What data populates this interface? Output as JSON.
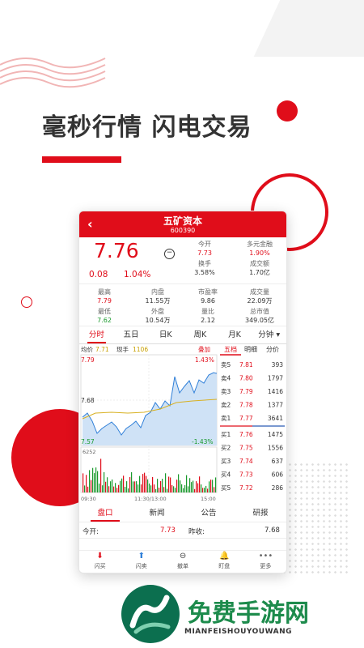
{
  "headline": "毫秒行情 闪电交易",
  "stock": {
    "name": "五矿资本",
    "code": "600390",
    "price": "7.76",
    "change": "0.08",
    "change_pct": "1.04%"
  },
  "quote_kv": [
    {
      "k": "今开",
      "v": "7.73",
      "c": "r"
    },
    {
      "k": "多元金融",
      "v": "1.90%",
      "c": "r"
    },
    {
      "k": "换手",
      "v": "3.58%",
      "c": "v"
    },
    {
      "k": "成交额",
      "v": "1.70亿",
      "c": "v"
    }
  ],
  "stats": [
    {
      "k": "最高",
      "v": "7.79",
      "c": "r"
    },
    {
      "k": "内盘",
      "v": "11.55万",
      "c": "v"
    },
    {
      "k": "市盈率",
      "v": "9.86",
      "c": "v"
    },
    {
      "k": "成交量",
      "v": "22.09万",
      "c": "v"
    },
    {
      "k": "最低",
      "v": "7.62",
      "c": "g"
    },
    {
      "k": "外盘",
      "v": "10.54万",
      "c": "v"
    },
    {
      "k": "量比",
      "v": "2.12",
      "c": "v"
    },
    {
      "k": "总市值",
      "v": "349.05亿",
      "c": "v"
    }
  ],
  "tabs": [
    "分时",
    "五日",
    "日K",
    "周K",
    "月K",
    "分钟 ▾"
  ],
  "chart": {
    "avg_label": "均价",
    "avg_val": "7.71",
    "now_label": "现手",
    "now_val": "1106",
    "overlay": "叠加",
    "hi": "7.79",
    "mid": "7.68",
    "lo": "7.57",
    "hi_pct": "1.43%",
    "lo_pct": "-1.43%",
    "vol": "6252",
    "t0": "09:30",
    "t1": "11:30/13:00",
    "t2": "15:00"
  },
  "book_tabs": [
    "五档",
    "明细",
    "分价"
  ],
  "asks": [
    {
      "l": "卖5",
      "p": "7.81",
      "v": "393"
    },
    {
      "l": "卖4",
      "p": "7.80",
      "v": "1797"
    },
    {
      "l": "卖3",
      "p": "7.79",
      "v": "1416"
    },
    {
      "l": "卖2",
      "p": "7.78",
      "v": "1377"
    },
    {
      "l": "卖1",
      "p": "7.77",
      "v": "3641"
    }
  ],
  "bids": [
    {
      "l": "买1",
      "p": "7.76",
      "v": "1475"
    },
    {
      "l": "买2",
      "p": "7.75",
      "v": "1556"
    },
    {
      "l": "买3",
      "p": "7.74",
      "v": "637"
    },
    {
      "l": "买4",
      "p": "7.73",
      "v": "606"
    },
    {
      "l": "买5",
      "p": "7.72",
      "v": "286"
    }
  ],
  "bottom_tabs": [
    "盘口",
    "新闻",
    "公告",
    "研报"
  ],
  "open_row": {
    "k1": "今开:",
    "v1": "7.73",
    "k2": "昨收:",
    "v2": "7.68"
  },
  "nav": [
    {
      "icon": "⬇",
      "label": "闪买"
    },
    {
      "icon": "⬆",
      "label": "闪卖"
    },
    {
      "icon": "⊖",
      "label": "撤单"
    },
    {
      "icon": "🔔",
      "label": "盯盘"
    },
    {
      "icon": "•••",
      "label": "更多"
    }
  ],
  "logo": {
    "title": "免费手游网",
    "sub": "MIANFEISHOUYOUWANG"
  },
  "colors": {
    "red": "#e00d1a",
    "green": "#1a9a2d",
    "blue": "#2f7fd8"
  }
}
